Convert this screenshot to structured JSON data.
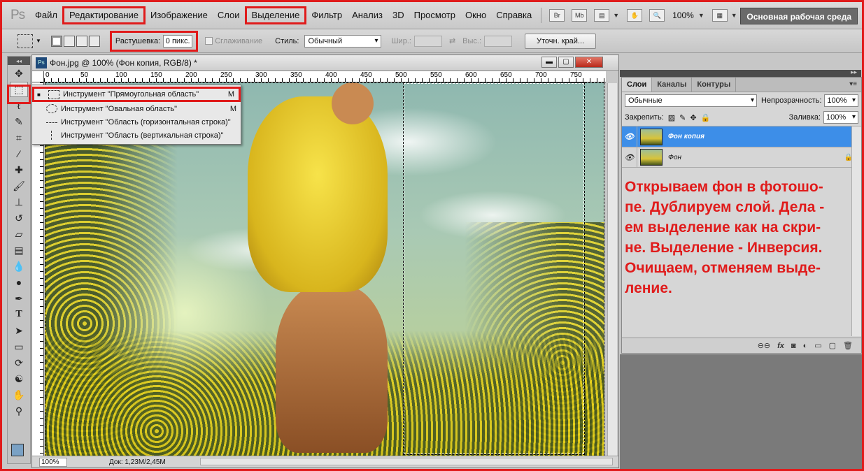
{
  "app": {
    "logo": "Ps"
  },
  "menu": {
    "items": [
      "Файл",
      "Редактирование",
      "Изображение",
      "Слои",
      "Выделение",
      "Фильтр",
      "Анализ",
      "3D",
      "Просмотр",
      "Окно",
      "Справка"
    ],
    "br": "Br",
    "mb": "Mb",
    "zoom": "100%",
    "workspace": "Основная рабочая среда"
  },
  "options": {
    "feather_label": "Растушевка:",
    "feather_value": "0 пикс.",
    "antialias_label": "Сглаживание",
    "style_label": "Стиль:",
    "style_value": "Обычный",
    "width_label": "Шир.:",
    "height_label": "Выс.:",
    "refine_label": "Уточн. край..."
  },
  "document": {
    "title": "Фон.jpg @ 100% (Фон копия, RGB/8) *",
    "ruler_labels": [
      "0",
      "50",
      "100",
      "150",
      "200",
      "250",
      "300",
      "350",
      "400",
      "450",
      "500",
      "550",
      "600",
      "650",
      "700",
      "750"
    ],
    "zoom": "100%",
    "status": "Док: 1,23M/2,45M"
  },
  "flyout": {
    "items": [
      {
        "label": "Инструмент \"Прямоугольная область\"",
        "key": "M"
      },
      {
        "label": "Инструмент \"Овальная область\"",
        "key": "M"
      },
      {
        "label": "Инструмент \"Область (горизонтальная строка)\"",
        "key": ""
      },
      {
        "label": "Инструмент \"Область (вертикальная строка)\"",
        "key": ""
      }
    ]
  },
  "layers_panel": {
    "tabs": [
      "Слои",
      "Каналы",
      "Контуры"
    ],
    "blend_mode": "Обычные",
    "opacity_label": "Непрозрачность:",
    "opacity_value": "100%",
    "lock_label": "Закрепить:",
    "fill_label": "Заливка:",
    "fill_value": "100%",
    "layers": [
      {
        "name": "Фон копия",
        "selected": true
      },
      {
        "name": "Фон",
        "selected": false
      }
    ],
    "footer_fx": "fx"
  },
  "instruction": "Открываем фон в фотошо-\nпе. Дублируем слой. Дела -\nем выделение как на скри-\nне. Выделение - Инверсия.\nОчищаем, отменяем выде-\nление.",
  "colors": {
    "annotation_red": "#e01b1b",
    "selection_blue": "#3d8ee8",
    "foreground_swatch": "#7aa1c4"
  }
}
